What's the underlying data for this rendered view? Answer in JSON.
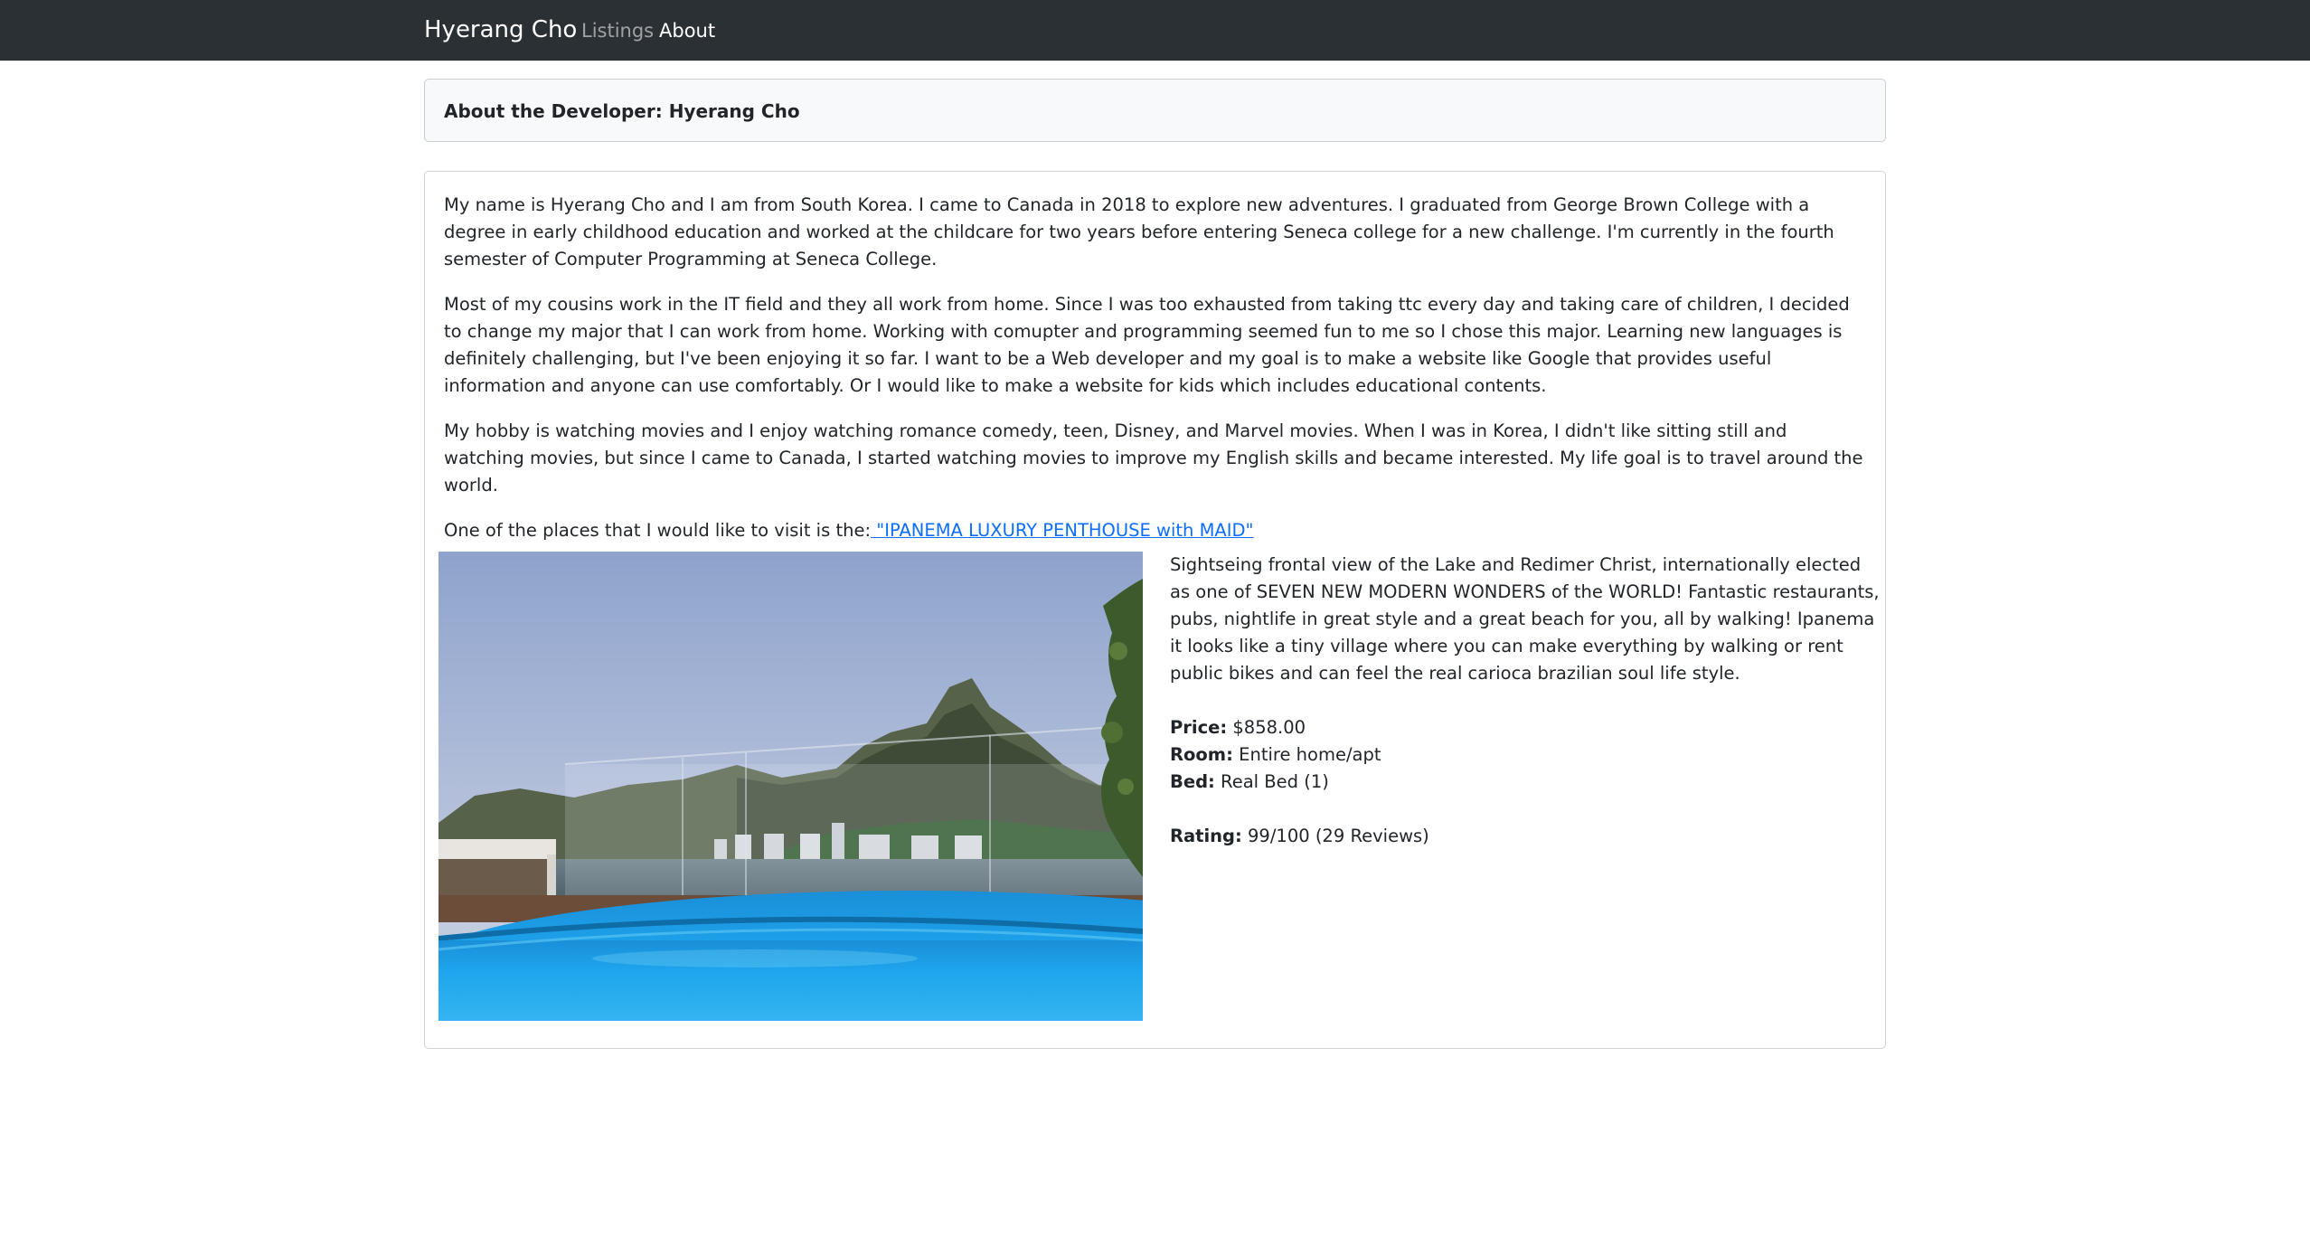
{
  "navbar": {
    "brand": "Hyerang Cho",
    "links": [
      {
        "label": "Listings",
        "active": false
      },
      {
        "label": "About",
        "active": true
      }
    ],
    "background": "#2b3035"
  },
  "header": {
    "title": "About the Developer: Hyerang Cho"
  },
  "bio": {
    "paragraphs": [
      "My name is Hyerang Cho and I am from South Korea. I came to Canada in 2018 to explore new adventures. I graduated from George Brown College with a degree in early childhood education and worked at the childcare for two years before entering Seneca college for a new challenge. I'm currently in the fourth semester of Computer Programming at Seneca College.",
      "Most of my cousins work in the IT field and they all work from home. Since I was too exhausted from taking ttc every day and taking care of children, I decided to change my major that I can work from home. Working with comupter and programming seemed fun to me so I chose this major. Learning new languages is definitely challenging, but I've been enjoying it so far. I want to be a Web developer and my goal is to make a website like Google that provides useful information and anyone can use comfortably. Or I would like to make a website for kids which includes educational contents.",
      "My hobby is watching movies and I enjoy watching romance comedy, teen, Disney, and Marvel movies. When I was in Korea, I didn't like sitting still and watching movies, but since I came to Canada, I started watching movies to improve my English skills and became interested. My life goal is to travel around the world."
    ],
    "visit_prefix": "One of the places that I would like to visit is the:",
    "visit_link": " \"IPANEMA LUXURY PENTHOUSE with MAID\"",
    "link_color": "#0d6efd"
  },
  "listing": {
    "description": "Sightseing frontal view of the Lake and Redimer Christ, internationally elected as one of SEVEN NEW MODERN WONDERS of the WORLD! Fantastic restaurants, pubs, nightlife in great style and a great beach for you, all by walking! Ipanema it looks like a tiny village where you can make everything by walking or rent public bikes and can feel the real carioca brazilian soul life style.",
    "price_label": "Price:",
    "price_value": " $858.00",
    "room_label": "Room:",
    "room_value": " Entire home/apt",
    "bed_label": "Bed:",
    "bed_value": " Real Bed (1)",
    "rating_label": "Rating:",
    "rating_value": " 99/100 (29 Reviews)",
    "photo_icon": "rooftop-pool-lake-view-photo"
  }
}
